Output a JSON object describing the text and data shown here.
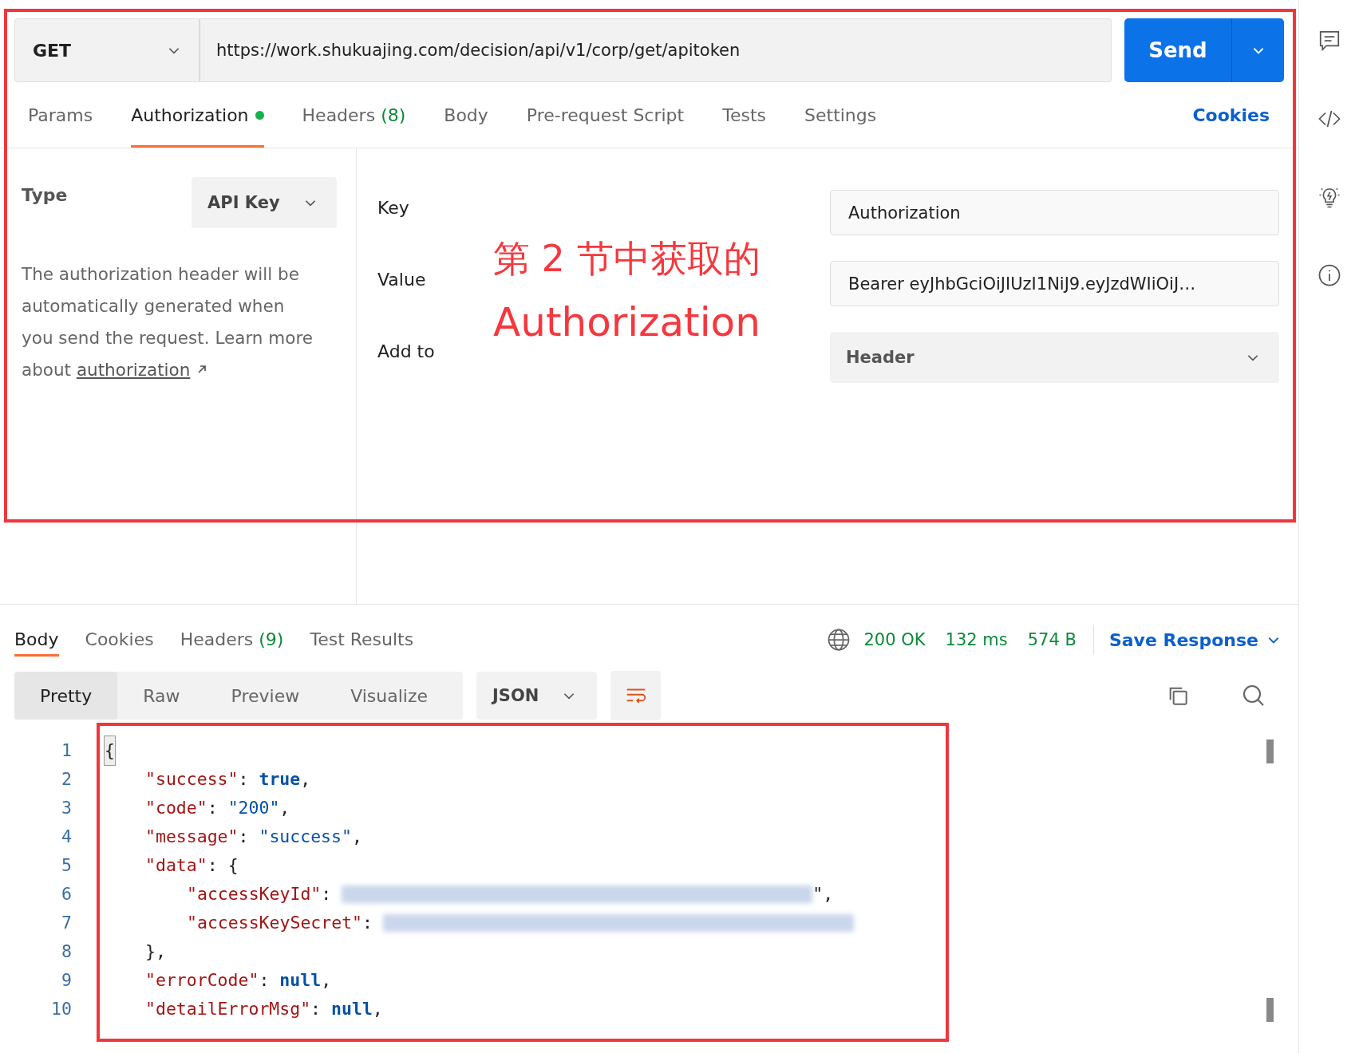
{
  "request": {
    "method": "GET",
    "url": "https://work.shukuajing.com/decision/api/v1/corp/get/apitoken",
    "send_label": "Send"
  },
  "request_tabs": [
    {
      "label": "Params",
      "dot": false,
      "selected": false
    },
    {
      "label": "Authorization",
      "dot": true,
      "selected": true
    },
    {
      "label": "Headers",
      "count": "(8)",
      "dot": false,
      "selected": false
    },
    {
      "label": "Body",
      "dot": false,
      "selected": false
    },
    {
      "label": "Pre-request Script",
      "dot": false,
      "selected": false
    },
    {
      "label": "Tests",
      "dot": false,
      "selected": false
    },
    {
      "label": "Settings",
      "dot": false,
      "selected": false
    }
  ],
  "cookies_link": "Cookies",
  "auth": {
    "type_label": "Type",
    "type_value": "API Key",
    "description": "The authorization header will be automatically generated when you send the request. Learn more about",
    "link": "authorization",
    "fields": [
      {
        "label": "Key",
        "kind": "input",
        "value": "Authorization"
      },
      {
        "label": "Value",
        "kind": "input",
        "value": "Bearer eyJhbGciOiJIUzI1NiJ9.eyJzdWIiOiJ…"
      },
      {
        "label": "Add to",
        "kind": "select",
        "value": "Header"
      }
    ]
  },
  "annotation": {
    "lines": [
      "第 2 节中获取的",
      "Authorization"
    ]
  },
  "response_tabs": [
    {
      "label": "Body",
      "selected": true
    },
    {
      "label": "Cookies",
      "selected": false
    },
    {
      "label": "Headers",
      "count": "(9)",
      "selected": false
    },
    {
      "label": "Test Results",
      "selected": false
    }
  ],
  "status": {
    "code": "200 OK",
    "time": "132 ms",
    "size": "574 B"
  },
  "save_label": "Save Response",
  "view_modes": [
    {
      "label": "Pretty",
      "selected": true
    },
    {
      "label": "Raw",
      "selected": false
    },
    {
      "label": "Preview",
      "selected": false
    },
    {
      "label": "Visualize",
      "selected": false
    }
  ],
  "format": "JSON",
  "code_lines": [
    {
      "number": "1",
      "kind": "root",
      "tokens": [
        {
          "kind": "bracket",
          "text": "{"
        }
      ]
    },
    {
      "number": "2",
      "kind": "member",
      "tokens": [
        {
          "kind": "key",
          "text": "\"success\""
        },
        {
          "kind": "punct",
          "text": ":"
        },
        {
          "kind": "keyword",
          "text": "true"
        },
        {
          "kind": "punct",
          "text": ","
        }
      ]
    },
    {
      "number": "3",
      "kind": "member",
      "tokens": [
        {
          "kind": "key",
          "text": "\"code\""
        },
        {
          "kind": "punct",
          "text": ":"
        },
        {
          "kind": "string",
          "text": "\"200\""
        },
        {
          "kind": "punct",
          "text": ","
        }
      ]
    },
    {
      "number": "4",
      "kind": "member",
      "tokens": [
        {
          "kind": "key",
          "text": "\"message\""
        },
        {
          "kind": "punct",
          "text": ":"
        },
        {
          "kind": "string",
          "text": "\"success\""
        },
        {
          "kind": "punct",
          "text": ","
        }
      ]
    },
    {
      "number": "5",
      "kind": "member",
      "tokens": [
        {
          "kind": "key",
          "text": "\"data\""
        },
        {
          "kind": "punct",
          "text": ":"
        },
        {
          "kind": "punct",
          "text": "{"
        }
      ]
    },
    {
      "number": "6",
      "kind": "nested",
      "tokens": [
        {
          "kind": "key",
          "text": "\"accessKeyId\""
        },
        {
          "kind": "punct",
          "text": ":"
        },
        {
          "kind": "redacted"
        },
        {
          "kind": "punct",
          "text": "\","
        }
      ]
    },
    {
      "number": "7",
      "kind": "nested",
      "tokens": [
        {
          "kind": "key",
          "text": "\"accessKeySecret\""
        },
        {
          "kind": "punct",
          "text": ":"
        },
        {
          "kind": "redacted"
        }
      ]
    },
    {
      "number": "8",
      "kind": "member",
      "tokens": [
        {
          "kind": "punct",
          "text": "},"
        }
      ]
    },
    {
      "number": "9",
      "kind": "member",
      "tokens": [
        {
          "kind": "key",
          "text": "\"errorCode\""
        },
        {
          "kind": "punct",
          "text": ":"
        },
        {
          "kind": "keyword",
          "text": "null"
        },
        {
          "kind": "punct",
          "text": ","
        }
      ]
    },
    {
      "number": "10",
      "kind": "member",
      "tokens": [
        {
          "kind": "key",
          "text": "\"detailErrorMsg\""
        },
        {
          "kind": "punct",
          "text": ":"
        },
        {
          "kind": "keyword",
          "text": "null"
        },
        {
          "kind": "punct",
          "text": ","
        }
      ]
    }
  ]
}
